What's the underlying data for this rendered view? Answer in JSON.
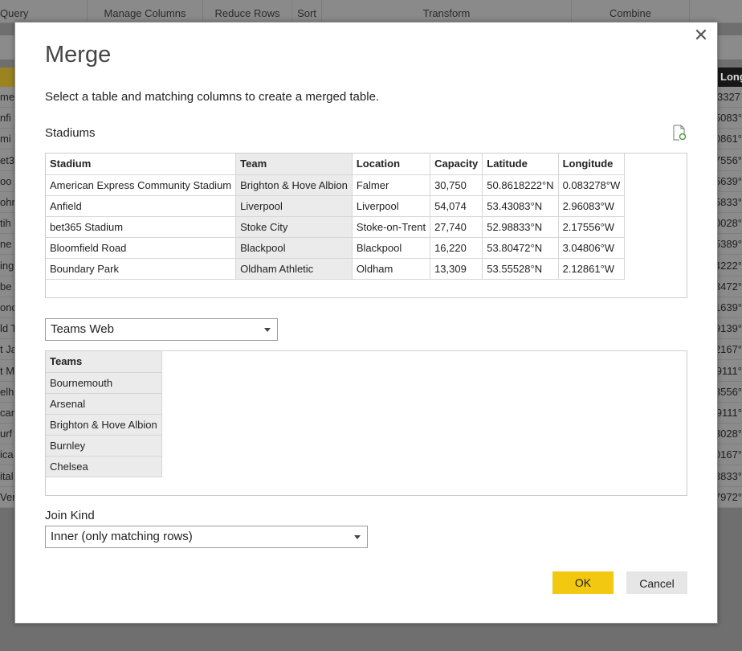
{
  "ribbon": {
    "groups": [
      "Query",
      "Manage Columns",
      "Reduce Rows",
      "Sort",
      "Transform",
      "Combine"
    ]
  },
  "background_grid": {
    "left_column_fragments": [
      "me",
      "nfi",
      "mi",
      "et3",
      "oo",
      "ohn",
      "tih",
      "ne",
      "ing",
      "be",
      "ond",
      "ld T",
      "t Ja",
      "t M",
      "elh",
      "cam",
      "urf",
      "ica",
      "ital",
      "Ver"
    ],
    "right_column_header": "Long",
    "right_column_fragments": [
      "3327",
      "5083°",
      "0861°",
      "7556°",
      "5639°",
      "5833°",
      "0028°",
      "5389°",
      "4222°",
      "3472°",
      "1639°",
      "9139°",
      "2167°",
      "9111°",
      "3556°",
      "9111°",
      "3028°",
      "0167°",
      "3833°",
      "7972°"
    ]
  },
  "dialog": {
    "title": "Merge",
    "description": "Select a table and matching columns to create a merged table.",
    "close_glyph": "✕",
    "table1": {
      "name": "Stadiums",
      "columns": [
        "Stadium",
        "Team",
        "Location",
        "Capacity",
        "Latitude",
        "Longitude"
      ],
      "selected_column": "Team",
      "rows": [
        [
          "American Express Community Stadium",
          "Brighton & Hove Albion",
          "Falmer",
          "30,750",
          "50.8618222°N",
          "0.083278°W"
        ],
        [
          "Anfield",
          "Liverpool",
          "Liverpool",
          "54,074",
          "53.43083°N",
          "2.96083°W"
        ],
        [
          "bet365 Stadium",
          "Stoke City",
          "Stoke-on-Trent",
          "27,740",
          "52.98833°N",
          "2.17556°W"
        ],
        [
          "Bloomfield Road",
          "Blackpool",
          "Blackpool",
          "16,220",
          "53.80472°N",
          "3.04806°W"
        ],
        [
          "Boundary Park",
          "Oldham Athletic",
          "Oldham",
          "13,309",
          "53.55528°N",
          "2.12861°W"
        ]
      ]
    },
    "table2": {
      "selected": "Teams Web",
      "columns": [
        "Teams"
      ],
      "selected_column": "Teams",
      "rows": [
        [
          "Bournemouth"
        ],
        [
          "Arsenal"
        ],
        [
          "Brighton & Hove Albion"
        ],
        [
          "Burnley"
        ],
        [
          "Chelsea"
        ]
      ]
    },
    "join_kind": {
      "label": "Join Kind",
      "selected": "Inner (only matching rows)"
    },
    "buttons": {
      "ok": "OK",
      "cancel": "Cancel"
    }
  },
  "colors": {
    "accent": "#f2c811",
    "selected_column_bg": "#ebebeb",
    "overlay": "#6f6f6f"
  }
}
